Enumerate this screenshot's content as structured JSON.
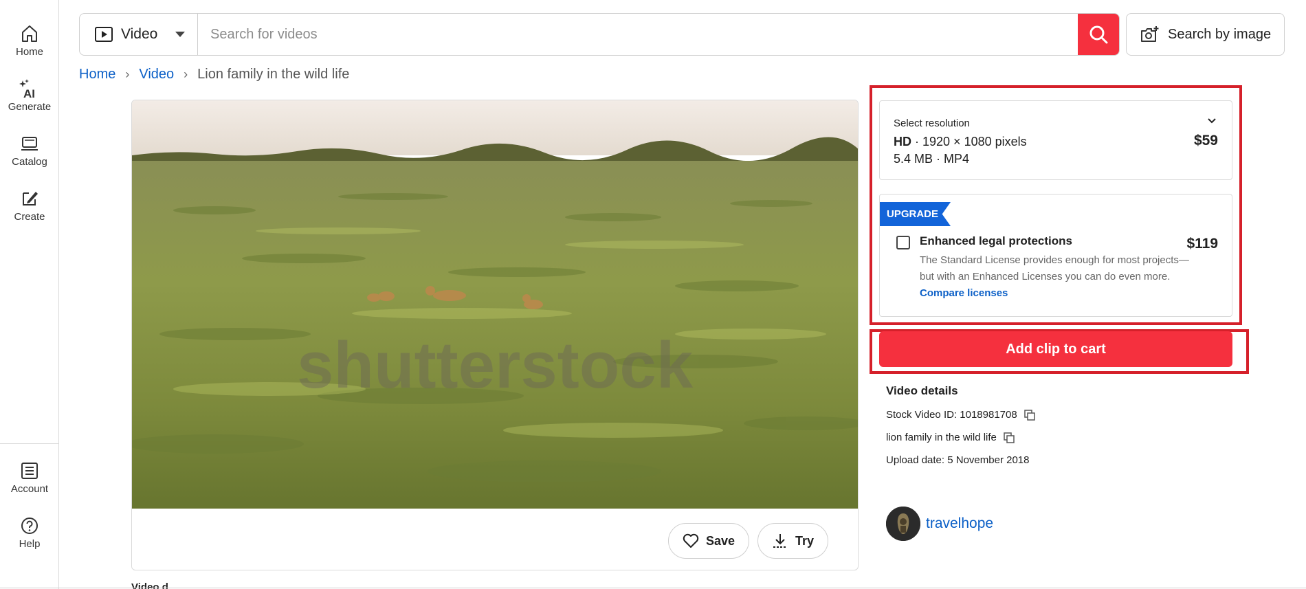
{
  "sidebar": {
    "items": [
      {
        "label": "Home",
        "icon": "home-icon"
      },
      {
        "label": "Generate",
        "icon": "ai-sparkle-icon"
      },
      {
        "label": "Catalog",
        "icon": "catalog-icon"
      },
      {
        "label": "Create",
        "icon": "create-edit-icon"
      }
    ],
    "bottom_items": [
      {
        "label": "Account",
        "icon": "account-icon"
      },
      {
        "label": "Help",
        "icon": "help-icon"
      }
    ]
  },
  "search": {
    "type_label": "Video",
    "placeholder": "Search for videos",
    "value": "",
    "image_search_label": "Search by image",
    "button_color": "#f5303e"
  },
  "breadcrumb": {
    "home": "Home",
    "section": "Video",
    "current": "Lion family in the wild life"
  },
  "media": {
    "watermark": "shutterstock",
    "actions": {
      "save_label": "Save",
      "try_label": "Try"
    }
  },
  "purchase": {
    "resolution": {
      "title": "Select resolution",
      "quality": "HD",
      "dimensions": "· 1920 × 1080 pixels",
      "file_info": "5.4 MB · MP4",
      "price": "$59"
    },
    "upgrade": {
      "badge": "UPGRADE",
      "title": "Enhanced legal protections",
      "description": "The Standard License provides enough for most projects—but with an Enhanced Licenses you can do even more.",
      "link": "Compare licenses",
      "price": "$119",
      "checked": false
    },
    "cart_label": "Add clip to cart",
    "accent_color": "#f5303e",
    "highlight_color": "#d5202a"
  },
  "details": {
    "title": "Video details",
    "stock_id": "Stock Video ID: 1018981708",
    "description": "lion family in the wild life",
    "upload_date": "Upload date: 5 November 2018"
  },
  "contributor": {
    "name": "travelhope"
  },
  "below_fold": {
    "partial_heading": "Video d"
  }
}
